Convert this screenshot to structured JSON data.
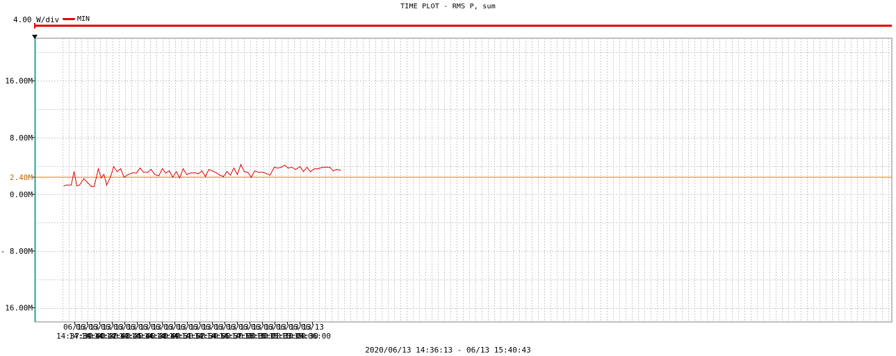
{
  "title": "TIME PLOT - RMS  P, sum",
  "scale_label": "4.00 W/div",
  "legend": {
    "label": "MIN",
    "color": "#e00000"
  },
  "footer": "2020/06/13 14:36:13 - 06/13 15:40:43",
  "colors": {
    "series": "#e00000",
    "reference": "#e07a00",
    "reference_label": "#c86400",
    "cursor": "#2aa198",
    "grid": "#c8c8c8",
    "frame": "#808080"
  },
  "chart_data": {
    "type": "line",
    "title": "TIME PLOT - RMS  P, sum",
    "xlabel": "2020/06/13 14:36:13 - 06/13 15:40:43",
    "ylabel": "",
    "x_time_range": [
      "14:36:13",
      "15:40:43"
    ],
    "ylim": [
      -18.0,
      22.0
    ],
    "y_ticks": [
      {
        "value": 16.0,
        "label": "16.00M"
      },
      {
        "value": 8.0,
        "label": "8.00M"
      },
      {
        "value": 2.4,
        "label": "2.40M"
      },
      {
        "value": 0.0,
        "label": "0.00M"
      },
      {
        "value": -8.0,
        "label": "- 8.00M"
      },
      {
        "value": -16.0,
        "label": "- 16.00M"
      }
    ],
    "x_ticks": [
      {
        "time": "14:37:30",
        "date": "06/13"
      },
      {
        "time": "14:39:00",
        "date": "06/13"
      },
      {
        "time": "14:40:30",
        "date": "06/13"
      },
      {
        "time": "14:42:00",
        "date": "06/13"
      },
      {
        "time": "14:43:30",
        "date": "06/13"
      },
      {
        "time": "14:45:00",
        "date": "06/13"
      },
      {
        "time": "14:46:30",
        "date": "06/13"
      },
      {
        "time": "14:48:00",
        "date": "06/13"
      },
      {
        "time": "14:49:30",
        "date": "06/13"
      },
      {
        "time": "14:51:00",
        "date": "06/13"
      },
      {
        "time": "14:52:30",
        "date": "06/13"
      },
      {
        "time": "14:54:00",
        "date": "06/13"
      },
      {
        "time": "14:55:30",
        "date": "06/13"
      },
      {
        "time": "14:57:00",
        "date": "06/13"
      },
      {
        "time": "14:58:30",
        "date": "06/13"
      },
      {
        "time": "15:00:00",
        "date": "06/13"
      },
      {
        "time": "15:01:30",
        "date": "06/13"
      },
      {
        "time": "15:03:00",
        "date": "06/13"
      },
      {
        "time": "15:04:30",
        "date": "06/13"
      },
      {
        "time": "15:06:00",
        "date": "06/13"
      }
    ],
    "reference_line": {
      "value": 2.4,
      "label": "2.40M"
    },
    "series": [
      {
        "name": "MIN",
        "color": "#e00000",
        "points": [
          [
            "14:36:13",
            1.2
          ],
          [
            "14:36:35",
            1.3
          ],
          [
            "14:37:05",
            1.3
          ],
          [
            "14:37:25",
            3.2
          ],
          [
            "14:37:45",
            1.2
          ],
          [
            "14:38:05",
            1.3
          ],
          [
            "14:38:35",
            2.2
          ],
          [
            "14:39:05",
            1.6
          ],
          [
            "14:39:30",
            1.1
          ],
          [
            "14:39:50",
            1.1
          ],
          [
            "14:40:20",
            3.6
          ],
          [
            "14:40:40",
            2.3
          ],
          [
            "14:41:00",
            2.8
          ],
          [
            "14:41:20",
            1.3
          ],
          [
            "14:41:50",
            2.6
          ],
          [
            "14:42:10",
            3.9
          ],
          [
            "14:42:35",
            3.2
          ],
          [
            "14:43:00",
            3.6
          ],
          [
            "14:43:25",
            2.4
          ],
          [
            "14:43:55",
            2.8
          ],
          [
            "14:44:25",
            3.0
          ],
          [
            "14:44:55",
            3.0
          ],
          [
            "14:45:20",
            3.7
          ],
          [
            "14:45:45",
            3.1
          ],
          [
            "14:46:15",
            3.1
          ],
          [
            "14:46:40",
            3.5
          ],
          [
            "14:47:05",
            2.8
          ],
          [
            "14:47:35",
            2.6
          ],
          [
            "14:48:00",
            3.6
          ],
          [
            "14:48:25",
            3.0
          ],
          [
            "14:48:50",
            3.3
          ],
          [
            "14:49:15",
            2.4
          ],
          [
            "14:49:40",
            3.2
          ],
          [
            "14:50:05",
            2.3
          ],
          [
            "14:50:30",
            3.6
          ],
          [
            "14:50:55",
            2.8
          ],
          [
            "14:51:25",
            3.0
          ],
          [
            "14:52:00",
            3.0
          ],
          [
            "14:52:20",
            2.9
          ],
          [
            "14:52:45",
            3.3
          ],
          [
            "14:53:10",
            2.5
          ],
          [
            "14:53:35",
            3.5
          ],
          [
            "14:54:00",
            3.3
          ],
          [
            "14:54:30",
            3.0
          ],
          [
            "14:54:55",
            2.7
          ],
          [
            "14:55:20",
            2.5
          ],
          [
            "14:55:45",
            3.2
          ],
          [
            "14:56:10",
            2.7
          ],
          [
            "14:56:35",
            3.7
          ],
          [
            "14:57:00",
            2.8
          ],
          [
            "14:57:25",
            4.2
          ],
          [
            "14:57:50",
            3.2
          ],
          [
            "14:58:15",
            3.1
          ],
          [
            "14:58:40",
            2.4
          ],
          [
            "14:59:05",
            3.3
          ],
          [
            "14:59:35",
            3.1
          ],
          [
            "15:00:05",
            3.1
          ],
          [
            "15:00:30",
            2.9
          ],
          [
            "15:00:55",
            2.7
          ],
          [
            "15:01:25",
            3.8
          ],
          [
            "15:01:50",
            3.7
          ],
          [
            "15:02:15",
            3.8
          ],
          [
            "15:02:40",
            4.1
          ],
          [
            "15:03:05",
            3.7
          ],
          [
            "15:03:30",
            3.8
          ],
          [
            "15:04:00",
            3.5
          ],
          [
            "15:04:30",
            3.9
          ],
          [
            "15:04:55",
            3.2
          ],
          [
            "15:05:20",
            3.8
          ],
          [
            "15:05:45",
            3.2
          ],
          [
            "15:06:15",
            3.6
          ],
          [
            "15:06:40",
            3.6
          ],
          [
            "15:07:10",
            3.8
          ],
          [
            "15:07:35",
            3.8
          ],
          [
            "15:08:05",
            3.8
          ],
          [
            "15:08:30",
            3.3
          ],
          [
            "15:08:55",
            3.5
          ],
          [
            "15:09:20",
            3.4
          ]
        ]
      }
    ],
    "grid": true,
    "legend_position": "top-left"
  }
}
